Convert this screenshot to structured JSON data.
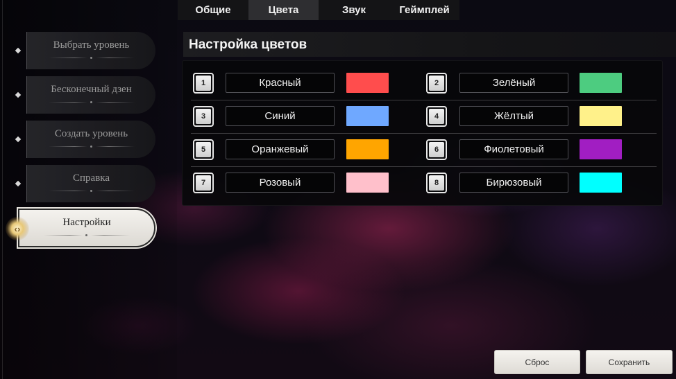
{
  "sidebar": {
    "items": [
      {
        "label": "Выбрать уровень"
      },
      {
        "label": "Бесконечный дзен"
      },
      {
        "label": "Создать уровень"
      },
      {
        "label": "Справка"
      },
      {
        "label": "Настройки"
      }
    ],
    "active_index": 4
  },
  "tabs": [
    {
      "label": "Общие"
    },
    {
      "label": "Цвета"
    },
    {
      "label": "Звук"
    },
    {
      "label": "Геймплей"
    }
  ],
  "active_tab": 1,
  "panel": {
    "title": "Настройка цветов"
  },
  "colors": [
    {
      "num": "1",
      "name": "Красный",
      "hex": "#ff4d4d"
    },
    {
      "num": "2",
      "name": "Зелёный",
      "hex": "#4dcc80"
    },
    {
      "num": "3",
      "name": "Синий",
      "hex": "#6fa8ff"
    },
    {
      "num": "4",
      "name": "Жёлтый",
      "hex": "#fff18a"
    },
    {
      "num": "5",
      "name": "Оранжевый",
      "hex": "#ffa500"
    },
    {
      "num": "6",
      "name": "Фиолетовый",
      "hex": "#a11ec2"
    },
    {
      "num": "7",
      "name": "Розовый",
      "hex": "#ffc0cb"
    },
    {
      "num": "8",
      "name": "Бирюзовый",
      "hex": "#00ffff"
    }
  ],
  "buttons": {
    "reset": "Сброс",
    "save": "Сохранить"
  }
}
